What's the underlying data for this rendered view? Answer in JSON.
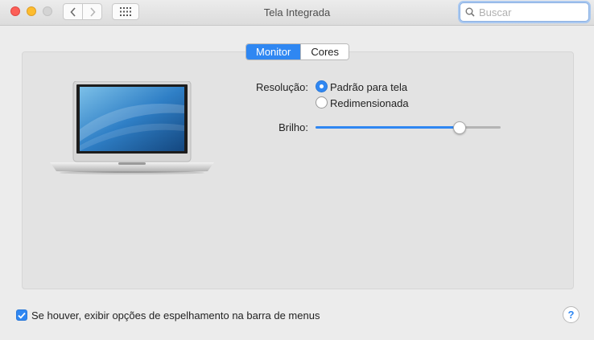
{
  "window": {
    "title": "Tela Integrada"
  },
  "search": {
    "placeholder": "Buscar",
    "value": ""
  },
  "tabs": [
    {
      "label": "Monitor",
      "active": true
    },
    {
      "label": "Cores",
      "active": false
    }
  ],
  "resolution": {
    "label": "Resolução:",
    "options": [
      {
        "label": "Padrão para tela",
        "selected": true
      },
      {
        "label": "Redimensionada",
        "selected": false
      }
    ]
  },
  "brightness": {
    "label": "Brilho:",
    "level": 0.78
  },
  "mirroring": {
    "label": "Se houver, exibir opções de espelhamento na barra de menus",
    "checked": true
  },
  "help": {
    "label": "?"
  },
  "icons": [
    "back-arrow-icon",
    "forward-arrow-icon",
    "grid-icon",
    "search-icon",
    "laptop-icon",
    "checkmark-icon"
  ],
  "colors": {
    "accent": "#2f87f2",
    "close": "#fc5f57",
    "minimize": "#fdbc2e",
    "zoom_disabled": "#d4d4d4"
  }
}
